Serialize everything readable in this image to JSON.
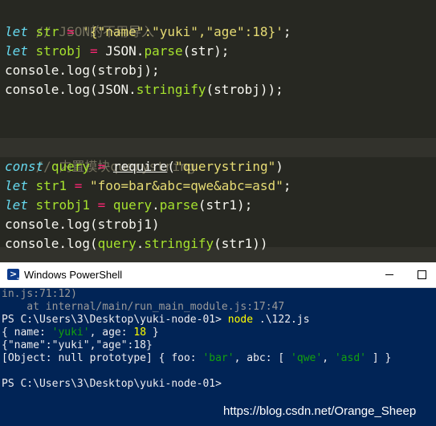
{
  "editor": {
    "line1": {
      "comment": "// JSON的不用导入"
    },
    "line2": {
      "kw": "let",
      "var": "str",
      "op": "=",
      "str": "'{\"name\":\"yuki\",\"age\":18}'",
      "end": ";"
    },
    "line3": {
      "kw": "let",
      "var": "strobj",
      "op": "=",
      "obj": "JSON",
      "dot": ".",
      "fn": "parse",
      "args": "(str);"
    },
    "line4": {
      "text": "console.log(strobj);"
    },
    "line5": {
      "p1": "console.log(",
      "obj": "JSON",
      "dot": ".",
      "fn": "stringify",
      "args": "(strobj));"
    },
    "line6": {
      "comment": "// 内置模块querystring"
    },
    "line7": {
      "kw": "const",
      "var": "query",
      "op": "=",
      "req": "require",
      "open": "(",
      "str": "\"querystring\"",
      "close": ")"
    },
    "line8": {
      "kw": "let",
      "var": "str1",
      "op": "=",
      "str": "\"foo=bar&abc=qwe&abc=asd\"",
      "end": ";"
    },
    "line9": {
      "kw": "let",
      "var": "strobj1",
      "op": "=",
      "obj": "query",
      "dot": ".",
      "fn": "parse",
      "args": "(str1);"
    },
    "line10": {
      "text": "console.log(strobj1)"
    },
    "line11": {
      "p1": "console.log(",
      "obj": "query",
      "dot": ".",
      "fn": "stringify",
      "args": "(str1))"
    }
  },
  "window": {
    "title": "Windows PowerShell",
    "icon": "powershell-icon"
  },
  "terminal": {
    "l1": "in.js:71:12)",
    "l2": "    at internal/main/run_main_module.js:17:47",
    "l3": {
      "prompt": "PS C:\\Users\\3\\Desktop\\yuki-node-01> ",
      "cmd": "node",
      "arg": " .\\122.js"
    },
    "l4": {
      "a": "{ name: ",
      "b": "'yuki'",
      "c": ", age: ",
      "d": "18",
      "e": " }"
    },
    "l5": "{\"name\":\"yuki\",\"age\":18}",
    "l6": {
      "a": "[Object: null prototype] { foo: ",
      "b": "'bar'",
      "c": ", abc: [ ",
      "d": "'qwe'",
      "e": ", ",
      "f": "'asd'",
      "g": " ] }"
    },
    "l7": "PS C:\\Users\\3\\Desktop\\yuki-node-01>"
  },
  "watermark": "https://blog.csdn.net/Orange_Sheep"
}
